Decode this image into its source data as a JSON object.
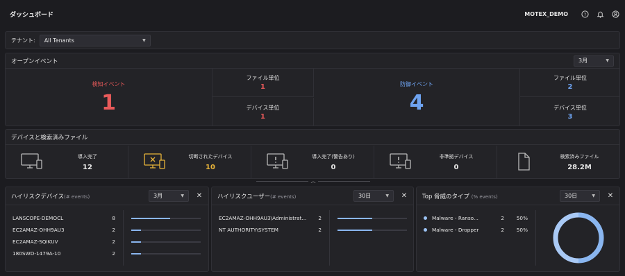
{
  "header": {
    "title": "ダッシュボード",
    "user": "MOTEX_DEMO"
  },
  "icons": {
    "help": "help-circle-icon",
    "bell": "bell-icon",
    "user": "user-icon"
  },
  "tenant": {
    "label": "テナント:",
    "value": "All Tenants"
  },
  "open_events": {
    "title": "オープンイベント",
    "period": "3月",
    "detect": {
      "label": "検知イベント",
      "value": "1",
      "file_label": "ファイル単位",
      "file_value": "1",
      "device_label": "デバイス単位",
      "device_value": "1"
    },
    "protect": {
      "label": "防御イベント",
      "value": "4",
      "file_label": "ファイル単位",
      "file_value": "2",
      "device_label": "デバイス単位",
      "device_value": "3"
    }
  },
  "devices": {
    "title": "デバイスと検索済みファイル",
    "cells": [
      {
        "label": "導入完了",
        "value": "12",
        "icon": "monitor-phone-icon"
      },
      {
        "label": "切断されたデバイス",
        "value": "10",
        "icon": "monitor-disconnected-icon"
      },
      {
        "label": "導入完了(警告あり)",
        "value": "0",
        "icon": "monitor-warning-icon"
      },
      {
        "label": "非準拠デバイス",
        "value": "0",
        "icon": "monitor-alert-icon"
      },
      {
        "label": "検索済みファイル",
        "value": "28.2M",
        "icon": "file-icon"
      }
    ]
  },
  "high_risk_devices": {
    "title": "ハイリスクデバイス",
    "subtitle": "(# events)",
    "period": "3月",
    "rows": [
      {
        "name": "LANSCOPE-DEMOCL",
        "count": "8",
        "ratio": 0.56
      },
      {
        "name": "EC2AMAZ-OHH9AU3",
        "count": "2",
        "ratio": 0.14
      },
      {
        "name": "EC2AMAZ-SQIKUV",
        "count": "2",
        "ratio": 0.14
      },
      {
        "name": "180SWD-1479A-10",
        "count": "2",
        "ratio": 0.14
      }
    ]
  },
  "high_risk_users": {
    "title": "ハイリスクユーザー",
    "subtitle": "(# events)",
    "period": "30日",
    "rows": [
      {
        "name": "EC2AMAZ-OHH9AU3\\Administrat...",
        "count": "2",
        "ratio": 0.5
      },
      {
        "name": "NT AUTHORITY\\SYSTEM",
        "count": "2",
        "ratio": 0.5
      }
    ]
  },
  "top_threats": {
    "title": "Top 脅威のタイプ",
    "subtitle": "(% events)",
    "period": "30日",
    "rows": [
      {
        "name": "Malware - Ranso...",
        "count": "2",
        "pct": "50%"
      },
      {
        "name": "Malware - Dropper",
        "count": "2",
        "pct": "50%"
      }
    ],
    "colors": {
      "series1": "#8ab6f0",
      "series2": "#a9c9f5"
    }
  },
  "colors": {
    "detect": "#e85a5a",
    "protect": "#6ea3f0",
    "disconnected": "#e8b43a"
  }
}
